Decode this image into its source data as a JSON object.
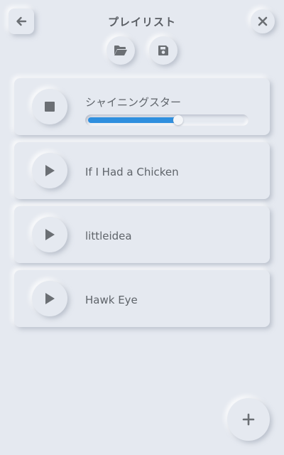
{
  "header": {
    "title": "プレイリスト",
    "back_icon": "arrow-left-icon",
    "close_icon": "close-icon",
    "open_icon": "folder-open-icon",
    "save_icon": "save-icon"
  },
  "playlist": {
    "items": [
      {
        "label": "シャイニングスター",
        "state": "playing",
        "icon": "stop-icon",
        "progress": 0.57
      },
      {
        "label": "If I Had a Chicken",
        "state": "stopped",
        "icon": "play-icon"
      },
      {
        "label": "littleidea",
        "state": "stopped",
        "icon": "play-icon"
      },
      {
        "label": "Hawk Eye",
        "state": "stopped",
        "icon": "play-icon"
      }
    ]
  },
  "footer": {
    "add_icon": "plus-icon"
  },
  "colors": {
    "accent": "#2f8fde",
    "background": "#e5e9f0",
    "icon": "#6b6f74"
  }
}
